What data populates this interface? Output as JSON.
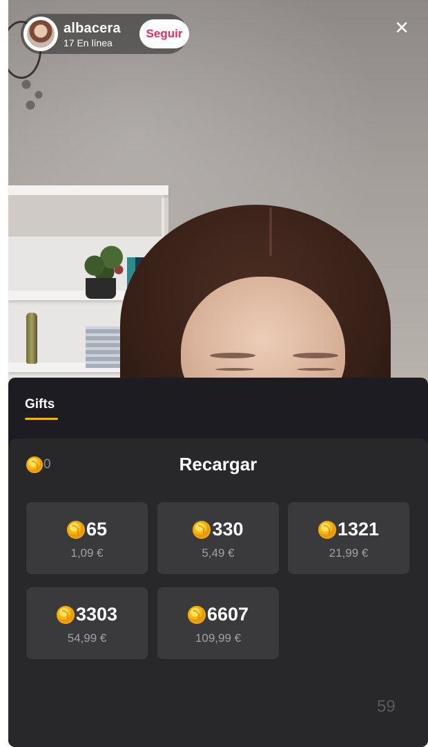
{
  "host": {
    "name": "albacera",
    "viewers": "17 En línea",
    "follow_label": "Seguir"
  },
  "close_icon": "×",
  "panel": {
    "tab_label": "Gifts",
    "balance": "0",
    "recharge_label": "Recargar",
    "packs": [
      {
        "coins": "65",
        "price": "1,09 €"
      },
      {
        "coins": "330",
        "price": "5,49 €"
      },
      {
        "coins": "1321",
        "price": "21,99 €"
      },
      {
        "coins": "3303",
        "price": "54,99 €"
      },
      {
        "coins": "6607",
        "price": "109,99 €"
      }
    ],
    "counter": "59"
  },
  "colors": {
    "accent_tab": "#f5b800",
    "follow_text": "#f2295b",
    "panel_bg": "#1c1c22",
    "wallet_bg": "#28282a",
    "pack_bg": "#3a3a3c"
  },
  "icons": [
    "coin-icon",
    "close-icon"
  ]
}
